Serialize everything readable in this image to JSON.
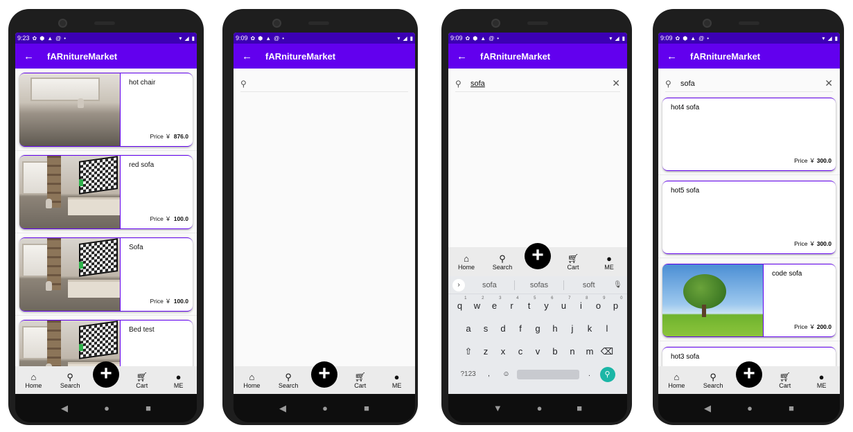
{
  "app": {
    "title": "fARnitureMarket"
  },
  "status": {
    "time_1": "9:23",
    "time_other": "9:09"
  },
  "nav": {
    "home": "Home",
    "search": "Search",
    "cart": "Cart",
    "me": "ME"
  },
  "screen1": {
    "items": [
      {
        "name": "hot chair",
        "price_label": "Price ￥",
        "price": "876.0"
      },
      {
        "name": "red sofa",
        "price_label": "Price ￥",
        "price": "100.0"
      },
      {
        "name": "Sofa",
        "price_label": "Price ￥",
        "price": "100.0"
      },
      {
        "name": "Bed test",
        "price_label": "",
        "price": ""
      }
    ]
  },
  "screen2": {
    "search_value": ""
  },
  "screen3": {
    "search_value": "sofa",
    "suggestions": [
      "sofa",
      "sofas",
      "soft"
    ],
    "keys_row1": [
      "q",
      "w",
      "e",
      "r",
      "t",
      "y",
      "u",
      "i",
      "o",
      "p"
    ],
    "keys_row1_hints": [
      "1",
      "2",
      "3",
      "4",
      "5",
      "6",
      "7",
      "8",
      "9",
      "0"
    ],
    "keys_row2": [
      "a",
      "s",
      "d",
      "f",
      "g",
      "h",
      "j",
      "k",
      "l"
    ],
    "keys_row3": [
      "z",
      "x",
      "c",
      "v",
      "b",
      "n",
      "m"
    ],
    "key_symbols": "?123",
    "key_comma": ",",
    "key_period": "."
  },
  "screen4": {
    "search_value": "sofa",
    "items": [
      {
        "name": "hot4 sofa",
        "price_label": "Price ￥",
        "price": "300.0"
      },
      {
        "name": "hot5 sofa",
        "price_label": "Price ￥",
        "price": "300.0"
      },
      {
        "name": "code sofa",
        "price_label": "Price ￥",
        "price": "200.0"
      },
      {
        "name": "hot3 sofa",
        "price_label": "",
        "price": ""
      }
    ]
  },
  "icons": {
    "back": "arrow-left",
    "home": "home",
    "search": "magnifier",
    "cart": "shopping-cart",
    "me": "person",
    "fab": "plus",
    "close": "x",
    "mic": "microphone",
    "emoji": "smiley",
    "shift": "shift-arrow",
    "backspace": "backspace"
  },
  "colors": {
    "primary": "#6200ee",
    "status_bar": "#3c00b4",
    "keyboard_action": "#1bb6a6"
  }
}
